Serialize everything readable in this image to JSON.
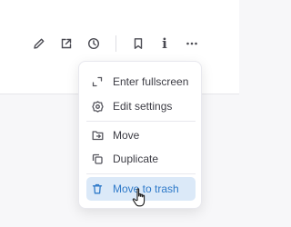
{
  "toolbar": {
    "icons": [
      "pencil-icon",
      "open-external-icon",
      "clock-icon",
      "bookmark-icon",
      "info-icon",
      "more-icon"
    ],
    "info_glyph": "i"
  },
  "menu": {
    "items": [
      {
        "label": "Enter fullscreen",
        "icon": "fullscreen-icon"
      },
      {
        "label": "Edit settings",
        "icon": "settings-icon"
      },
      {
        "label": "Move",
        "icon": "folder-move-icon"
      },
      {
        "label": "Duplicate",
        "icon": "duplicate-icon"
      },
      {
        "label": "Move to trash",
        "icon": "trash-icon"
      }
    ],
    "active_item": "Move to trash"
  },
  "colors": {
    "accent": "#2f7ac9",
    "active_bg": "#dbe9f8",
    "page_bg": "#f7f7f9"
  }
}
